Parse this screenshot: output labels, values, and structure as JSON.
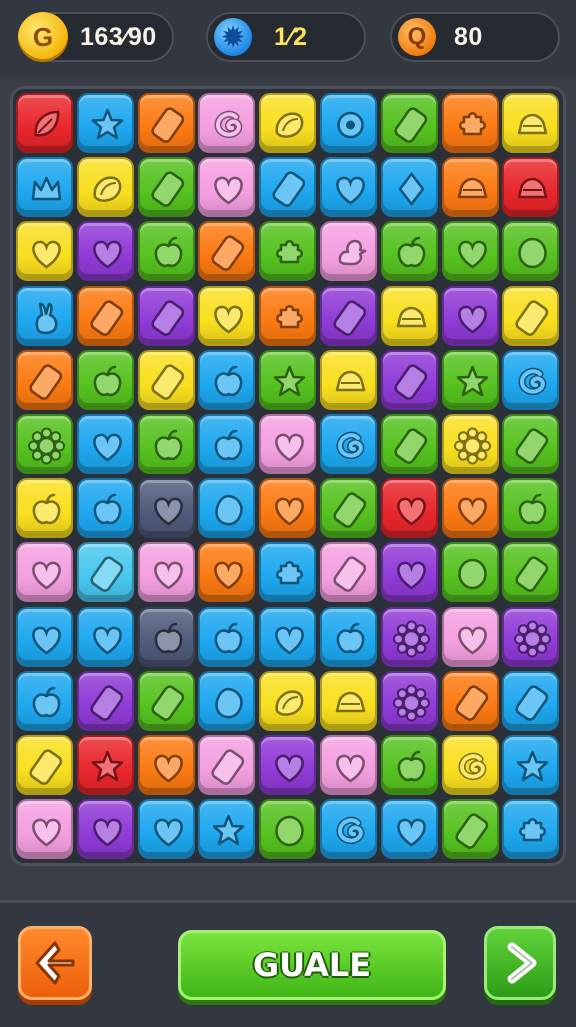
{
  "hud": {
    "coins": {
      "icon": "coin-icon",
      "value": "163⁄90"
    },
    "moves": {
      "icon": "gear-icon",
      "value": "1⁄2"
    },
    "target": {
      "icon": "target-icon",
      "value": "80"
    }
  },
  "palette": {
    "red": "#e8262b",
    "blue": "#1da7ef",
    "orange": "#fb7a12",
    "pink": "#f49fe0",
    "yellow": "#f9df1f",
    "green": "#55c21f",
    "purple": "#8f3ad6",
    "navy": "#4f5a7a",
    "ice": "#48c7ef"
  },
  "board": {
    "rows": [
      [
        [
          "red",
          "leaf"
        ],
        [
          "blue",
          "star"
        ],
        [
          "orange",
          "bar"
        ],
        [
          "pink",
          "swirl"
        ],
        [
          "yellow",
          "shell"
        ],
        [
          "blue",
          "drop"
        ],
        [
          "green",
          "bar"
        ],
        [
          "orange",
          "puzzle"
        ],
        [
          "yellow",
          "cake"
        ]
      ],
      [
        [
          "blue",
          "crown"
        ],
        [
          "yellow",
          "shell"
        ],
        [
          "green",
          "bar"
        ],
        [
          "pink",
          "heart"
        ],
        [
          "blue",
          "bar"
        ],
        [
          "blue",
          "heart"
        ],
        [
          "blue",
          "gem"
        ],
        [
          "orange",
          "cake"
        ],
        [
          "red",
          "cake"
        ]
      ],
      [
        [
          "yellow",
          "heart"
        ],
        [
          "purple",
          "heart"
        ],
        [
          "green",
          "apple"
        ],
        [
          "orange",
          "bar"
        ],
        [
          "green",
          "puzzle"
        ],
        [
          "pink",
          "duck"
        ],
        [
          "green",
          "apple"
        ],
        [
          "green",
          "heart"
        ],
        [
          "green",
          "oval"
        ]
      ],
      [
        [
          "blue",
          "bunny"
        ],
        [
          "orange",
          "bar"
        ],
        [
          "purple",
          "bar"
        ],
        [
          "yellow",
          "heart"
        ],
        [
          "orange",
          "puzzle"
        ],
        [
          "purple",
          "bar"
        ],
        [
          "yellow",
          "cake"
        ],
        [
          "purple",
          "heart"
        ],
        [
          "yellow",
          "bar"
        ]
      ],
      [
        [
          "orange",
          "bar"
        ],
        [
          "green",
          "apple"
        ],
        [
          "yellow",
          "bar"
        ],
        [
          "blue",
          "apple"
        ],
        [
          "green",
          "star"
        ],
        [
          "yellow",
          "cake"
        ],
        [
          "purple",
          "bar"
        ],
        [
          "green",
          "star"
        ],
        [
          "blue",
          "swirl"
        ]
      ],
      [
        [
          "green",
          "sun"
        ],
        [
          "blue",
          "heart"
        ],
        [
          "green",
          "apple"
        ],
        [
          "blue",
          "apple"
        ],
        [
          "pink",
          "heart"
        ],
        [
          "blue",
          "swirl"
        ],
        [
          "green",
          "bar"
        ],
        [
          "yellow",
          "sun"
        ],
        [
          "green",
          "bar"
        ]
      ],
      [
        [
          "yellow",
          "apple"
        ],
        [
          "blue",
          "apple"
        ],
        [
          "navy",
          "heart"
        ],
        [
          "blue",
          "blob"
        ],
        [
          "orange",
          "heart"
        ],
        [
          "green",
          "bar"
        ],
        [
          "red",
          "heart"
        ],
        [
          "orange",
          "heart"
        ],
        [
          "green",
          "apple"
        ]
      ],
      [
        [
          "pink",
          "heart"
        ],
        [
          "ice",
          "bar"
        ],
        [
          "pink",
          "heart"
        ],
        [
          "orange",
          "heart"
        ],
        [
          "blue",
          "puzzle"
        ],
        [
          "pink",
          "bar"
        ],
        [
          "purple",
          "heart"
        ],
        [
          "green",
          "oval"
        ],
        [
          "green",
          "bar"
        ]
      ],
      [
        [
          "blue",
          "heart"
        ],
        [
          "blue",
          "heart"
        ],
        [
          "navy",
          "apple"
        ],
        [
          "blue",
          "apple"
        ],
        [
          "blue",
          "heart"
        ],
        [
          "blue",
          "apple"
        ],
        [
          "purple",
          "sun"
        ],
        [
          "pink",
          "heart"
        ],
        [
          "purple",
          "sun"
        ]
      ],
      [
        [
          "blue",
          "apple"
        ],
        [
          "purple",
          "bar"
        ],
        [
          "green",
          "bar"
        ],
        [
          "blue",
          "blob"
        ],
        [
          "yellow",
          "shell"
        ],
        [
          "yellow",
          "cake"
        ],
        [
          "purple",
          "sun"
        ],
        [
          "orange",
          "bar"
        ],
        [
          "blue",
          "bar"
        ]
      ],
      [
        [
          "yellow",
          "bar"
        ],
        [
          "red",
          "star"
        ],
        [
          "orange",
          "heart"
        ],
        [
          "pink",
          "bar"
        ],
        [
          "purple",
          "heart"
        ],
        [
          "pink",
          "heart"
        ],
        [
          "green",
          "apple"
        ],
        [
          "yellow",
          "swirl"
        ],
        [
          "blue",
          "star"
        ]
      ],
      [
        [
          "pink",
          "heart"
        ],
        [
          "purple",
          "heart"
        ],
        [
          "blue",
          "heart"
        ],
        [
          "blue",
          "star"
        ],
        [
          "green",
          "oval"
        ],
        [
          "blue",
          "swirl"
        ],
        [
          "blue",
          "heart"
        ],
        [
          "green",
          "bar"
        ],
        [
          "blue",
          "puzzle"
        ]
      ]
    ]
  },
  "controls": {
    "back": {
      "icon": "back-icon"
    },
    "play_label": "GUALE",
    "next": {
      "icon": "chevron-right-icon"
    }
  }
}
